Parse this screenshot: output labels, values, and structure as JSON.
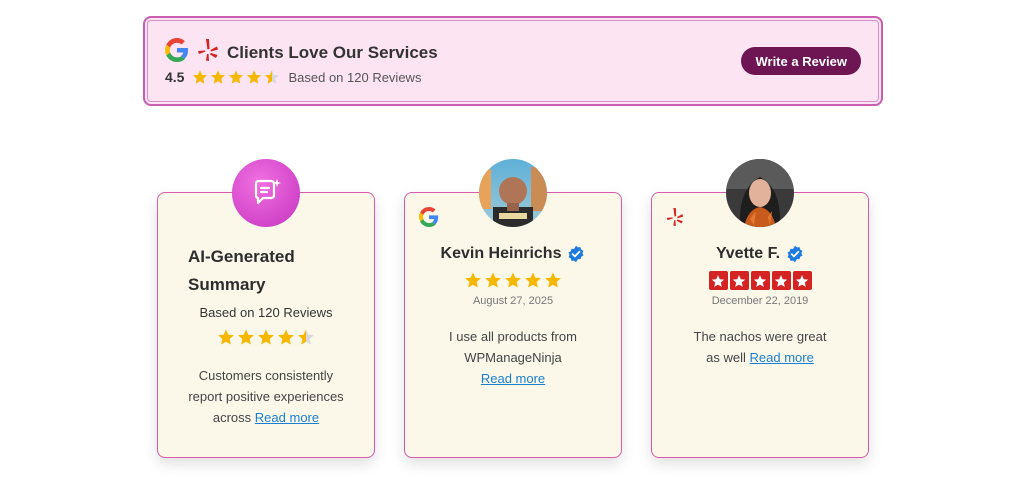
{
  "banner": {
    "title": "Clients Love Our Services",
    "score": "4.5",
    "based_on": "Based on 120 Reviews",
    "rating": 4.5,
    "write_review_label": "Write a Review"
  },
  "ai_card": {
    "title_line1": "AI-Generated",
    "title_line2": "Summary",
    "based_on": "Based on 120 Reviews",
    "rating": 4.5,
    "summary": "Customers consistently report positive experiences across",
    "read_more": "Read more"
  },
  "reviews": [
    {
      "source": "google",
      "name": "Kevin Heinrichs",
      "verified": true,
      "rating": 5,
      "date": "August 27, 2025",
      "text": "I use all products from WPManageNinja",
      "read_more": "Read more"
    },
    {
      "source": "yelp",
      "name": "Yvette F.",
      "verified": true,
      "rating": 5,
      "date": "December 22, 2019",
      "text": "The nachos were great as well",
      "read_more": "Read more"
    }
  ],
  "colors": {
    "banner_bg": "#fde4f3",
    "banner_border": "#c85fb0",
    "button_bg": "#6e1553",
    "card_bg": "#fbf8ea",
    "card_border": "#d85aa8",
    "star_gold": "#f6b700",
    "yelp_red": "#d32323",
    "verified_blue": "#1d7be0",
    "link_blue": "#1a7fd0"
  }
}
